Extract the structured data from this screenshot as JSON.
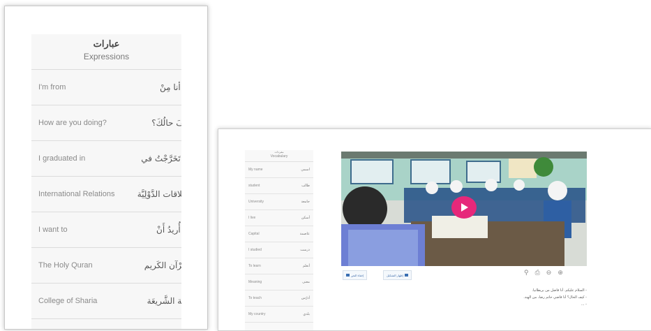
{
  "expressions": {
    "title_ar": "عبارات",
    "title_en": "Expressions",
    "rows": [
      {
        "en": "I'm from",
        "ar": "أنا مِنْ ..."
      },
      {
        "en": "How are you doing?",
        "ar": "كَيْفَ حالُكَ؟"
      },
      {
        "en": "I graduated in",
        "ar": "تَخَرَّجْتُ في ..."
      },
      {
        "en": "International Relations",
        "ar": "العَلاقات الدَّوْلِيَّة"
      },
      {
        "en": "I want to",
        "ar": "أُريدُ أَنْ ..."
      },
      {
        "en": "The Holy Quran",
        "ar": "القُرْآن الكَريم"
      },
      {
        "en": "College of Sharia",
        "ar": "كُلِّيَّة الشَّريعَة"
      }
    ]
  },
  "vocabulary": {
    "title_ar": "مفردات",
    "title_en": "Vocabulary",
    "rows": [
      {
        "en": "My name",
        "ar": "اسمي"
      },
      {
        "en": "student",
        "ar": "طالب"
      },
      {
        "en": "University",
        "ar": "جامعة"
      },
      {
        "en": "I live",
        "ar": "أسكن"
      },
      {
        "en": "Capital",
        "ar": "عاصمة"
      },
      {
        "en": "I studied",
        "ar": "درست"
      },
      {
        "en": "To learn",
        "ar": "أتعلم"
      },
      {
        "en": "Meaning",
        "ar": "معنى"
      },
      {
        "en": "To teach",
        "ar": "أدرّس"
      },
      {
        "en": "My country",
        "ar": "بلدي"
      }
    ]
  },
  "video": {
    "play_icon": "play-icon"
  },
  "toolbar": {
    "icons": [
      "link-icon",
      "print-icon",
      "zoom-out-icon",
      "zoom-in-icon"
    ],
    "glyphs": [
      "⚲",
      "⎙",
      "⊖",
      "⊕"
    ]
  },
  "buttons": {
    "btn1_label": "إخفاء النص",
    "btn2_label": "إظهار التشكيل"
  },
  "dialogue": [
    "- السلام عليكم. أنا فاضل من بريطانيا.",
    "- كيف الحال؟ أنا فاضي حاتم رضا، من الهند.",
    "- ..."
  ],
  "colors": {
    "accent": "#e6287a",
    "link_blue": "#3c6aa8"
  }
}
